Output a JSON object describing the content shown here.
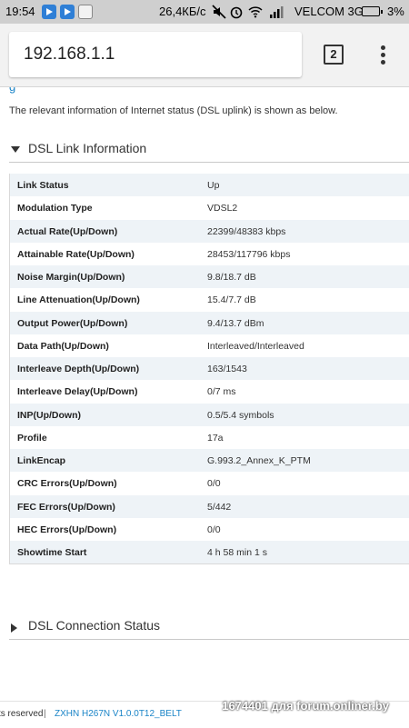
{
  "status_bar": {
    "time": "19:54",
    "speed": "26,4КБ/с",
    "carrier": "VELCOM 3G",
    "battery": "3%"
  },
  "browser": {
    "url": "192.168.1.1",
    "tab_count": "2"
  },
  "page": {
    "cut_link": "g",
    "intro": "The relevant information of Internet status (DSL uplink) is shown as below.",
    "dsl_link_title": "DSL Link Information",
    "dsl_connection_title": "DSL Connection Status",
    "rows": [
      {
        "key": "Link Status",
        "value": "Up"
      },
      {
        "key": "Modulation Type",
        "value": "VDSL2"
      },
      {
        "key": "Actual Rate(Up/Down)",
        "value": "22399/48383 kbps"
      },
      {
        "key": "Attainable Rate(Up/Down)",
        "value": "28453/117796 kbps"
      },
      {
        "key": "Noise Margin(Up/Down)",
        "value": "9.8/18.7 dB"
      },
      {
        "key": "Line Attenuation(Up/Down)",
        "value": "15.4/7.7 dB"
      },
      {
        "key": "Output Power(Up/Down)",
        "value": "9.4/13.7 dBm"
      },
      {
        "key": "Data Path(Up/Down)",
        "value": "Interleaved/Interleaved"
      },
      {
        "key": "Interleave Depth(Up/Down)",
        "value": "163/1543"
      },
      {
        "key": "Interleave Delay(Up/Down)",
        "value": "0/7 ms"
      },
      {
        "key": "INP(Up/Down)",
        "value": "0.5/5.4 symbols"
      },
      {
        "key": "Profile",
        "value": "17a"
      },
      {
        "key": "LinkEncap",
        "value": "G.993.2_Annex_K_PTM"
      },
      {
        "key": "CRC Errors(Up/Down)",
        "value": "0/0"
      },
      {
        "key": "FEC Errors(Up/Down)",
        "value": "5/442"
      },
      {
        "key": "HEC Errors(Up/Down)",
        "value": "0/0"
      },
      {
        "key": "Showtime Start",
        "value": "4 h 58 min 1 s"
      }
    ]
  },
  "footer": {
    "rights": "ts reserved",
    "separator": "|",
    "version": "ZXHN H267N V1.0.0T12_BELT",
    "watermark": "1674401 для forum.onliner.by"
  },
  "colors": {
    "link": "#1a84c7",
    "row_alt": "#eef3f7",
    "status_bar": "#cfcfcf"
  }
}
